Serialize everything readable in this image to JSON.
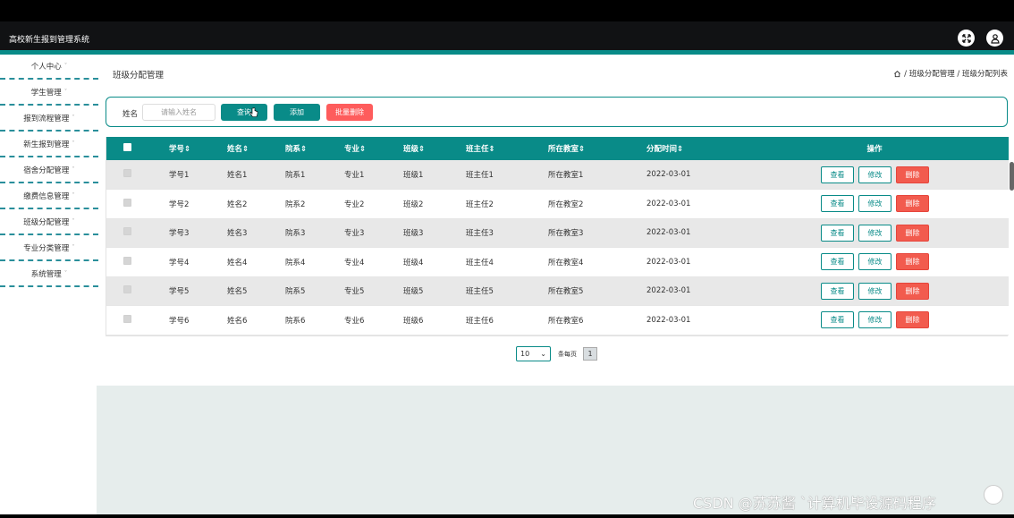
{
  "header": {
    "title": "高校新生报到管理系统"
  },
  "sidebar": {
    "items": [
      {
        "label": "个人中心"
      },
      {
        "label": "学生管理"
      },
      {
        "label": "报到流程管理"
      },
      {
        "label": "新生报到管理"
      },
      {
        "label": "宿舍分配管理"
      },
      {
        "label": "缴费信息管理"
      },
      {
        "label": "班级分配管理"
      },
      {
        "label": "专业分类管理"
      },
      {
        "label": "系统管理"
      }
    ],
    "chevron": "ˇ"
  },
  "page": {
    "title": "班级分配管理",
    "breadcrumb": "/ 班级分配管理 / 班级分配列表"
  },
  "search": {
    "label": "姓名",
    "placeholder": "请输入姓名",
    "search_button": "查询",
    "add_button": "添加",
    "batch_delete_button": "批量删除"
  },
  "table": {
    "headers": [
      "学号",
      "姓名",
      "院系",
      "专业",
      "班级",
      "班主任",
      "所在教室",
      "分配时间"
    ],
    "sort_mark": "⇕",
    "ops_header": "操作",
    "rows": [
      [
        "学号1",
        "姓名1",
        "院系1",
        "专业1",
        "班级1",
        "班主任1",
        "所在教室1",
        "2022-03-01"
      ],
      [
        "学号2",
        "姓名2",
        "院系2",
        "专业2",
        "班级2",
        "班主任2",
        "所在教室2",
        "2022-03-01"
      ],
      [
        "学号3",
        "姓名3",
        "院系3",
        "专业3",
        "班级3",
        "班主任3",
        "所在教室3",
        "2022-03-01"
      ],
      [
        "学号4",
        "姓名4",
        "院系4",
        "专业4",
        "班级4",
        "班主任4",
        "所在教室4",
        "2022-03-01"
      ],
      [
        "学号5",
        "姓名5",
        "院系5",
        "专业5",
        "班级5",
        "班主任5",
        "所在教室5",
        "2022-03-01"
      ],
      [
        "学号6",
        "姓名6",
        "院系6",
        "专业6",
        "班级6",
        "班主任6",
        "所在教室6",
        "2022-03-01"
      ]
    ],
    "ops": {
      "view": "查看",
      "edit": "修改",
      "delete": "删除"
    }
  },
  "pager": {
    "page_size": "10",
    "page_size_label": "条每页",
    "current_page": "1"
  },
  "watermark": "CSDN @苏苏酱 `计算机毕设源码程序",
  "colors": {
    "accent": "#098b88",
    "danger": "#fe5c5c",
    "header_bg": "#111214"
  }
}
